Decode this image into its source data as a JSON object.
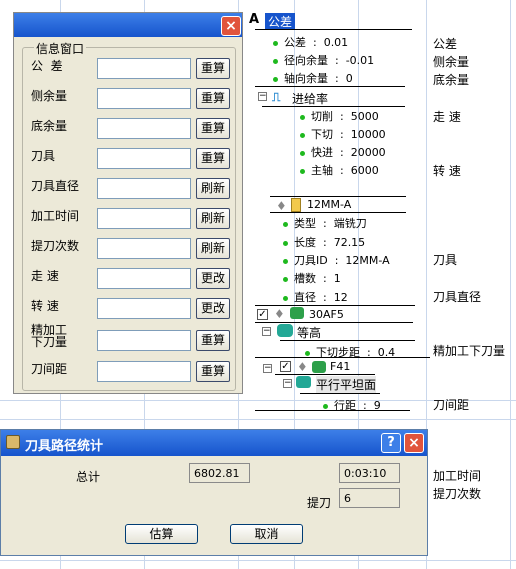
{
  "info_window": {
    "group_title": "信息窗口",
    "rows": [
      {
        "label": "公  差",
        "button": "重算"
      },
      {
        "label": "侧余量",
        "button": "重算"
      },
      {
        "label": "底余量",
        "button": "重算"
      },
      {
        "label": "刀具",
        "button": "重算"
      },
      {
        "label": "刀具直径",
        "button": "刷新"
      },
      {
        "label": "加工时间",
        "button": "刷新"
      },
      {
        "label": "提刀次数",
        "button": "刷新"
      },
      {
        "label": "走 速",
        "button": "更改"
      },
      {
        "label": "转 速",
        "button": "更改"
      },
      {
        "label": "精加工\n下刀量",
        "button": "重算"
      },
      {
        "label": "刀间距",
        "button": "重算"
      }
    ],
    "close": "×"
  },
  "tree": {
    "tolerance_header": "公差",
    "tolerance_items": [
      "公差  :  0.01",
      "径向余量  :  -0.01",
      "轴向余量  :  0"
    ],
    "feed_header": "进给率",
    "feed_items": [
      "切削  :  5000",
      "下切  :  10000",
      "快进  :  20000",
      "主轴  :  6000"
    ],
    "tool_header": "12MM-A",
    "tool_items": [
      "类型  :  端铣刀",
      "长度  :  72.15",
      "刀具ID  :  12MM-A",
      "槽数  :  1",
      "直径  :  12"
    ],
    "path_header": "30AF5",
    "contour_header": "等高",
    "contour_items": [
      "下切步距  :  0.4"
    ],
    "f41_header": "F41",
    "parallel_header": "平行平坦面",
    "parallel_items": [
      "行距  :  9"
    ]
  },
  "right_labels": {
    "tol": "公差",
    "side": "侧余量",
    "bottom": "底余量",
    "feed": "走 速",
    "spindle": "转 速",
    "tool": "刀具",
    "diameter": "刀具直径",
    "finish": "精加工下刀量",
    "step": "刀间距",
    "time": "加工时间",
    "lifts": "提刀次数"
  },
  "dialog": {
    "title": "刀具路径统计",
    "total_label": "总计",
    "total_value": "6802.81",
    "time_value": "0:03:10",
    "lift_label": "提刀",
    "lift_value": "6",
    "estimate_button": "估算",
    "cancel_button": "取消",
    "help": "?",
    "close": "×"
  }
}
